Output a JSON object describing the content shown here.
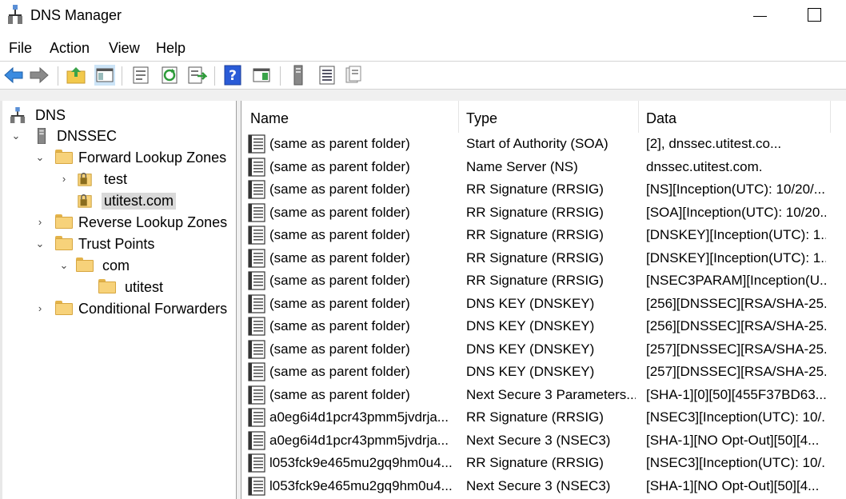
{
  "window": {
    "title": "DNS Manager"
  },
  "menu": [
    "File",
    "Action",
    "View",
    "Help"
  ],
  "toolbar": {
    "icons": [
      "back-arrow-icon",
      "forward-arrow-icon",
      "up-folder-icon",
      "show-hide-tree-icon",
      "properties-icon",
      "refresh-icon",
      "export-list-icon",
      "help-icon",
      "console-icon",
      "server-icon",
      "list-view-icon",
      "details-view-icon"
    ]
  },
  "tree": {
    "items": [
      {
        "label": "DNS",
        "level": 0,
        "chevron": "",
        "icon": "dns-server-icon"
      },
      {
        "label": "DNSSEC",
        "level": 1,
        "chevron": "v",
        "icon": "server-icon"
      },
      {
        "label": "Forward Lookup Zones",
        "level": 2,
        "chevron": "v",
        "icon": "folder-icon"
      },
      {
        "label": "test",
        "level": 3,
        "chevron": ">",
        "icon": "signed-zone-icon"
      },
      {
        "label": "utitest.com",
        "level": 3,
        "chevron": "",
        "icon": "signed-zone-icon",
        "selected": true
      },
      {
        "label": "Reverse Lookup Zones",
        "level": 2,
        "chevron": ">",
        "icon": "folder-icon"
      },
      {
        "label": "Trust Points",
        "level": 2,
        "chevron": "v",
        "icon": "folder-icon"
      },
      {
        "label": "com",
        "level": 3,
        "chevron": "v",
        "icon": "folder-icon"
      },
      {
        "label": "utitest",
        "level": 4,
        "chevron": "",
        "icon": "folder-icon"
      },
      {
        "label": "Conditional Forwarders",
        "level": 2,
        "chevron": ">",
        "icon": "folder-icon"
      }
    ]
  },
  "list": {
    "columns": [
      "Name",
      "Type",
      "Data"
    ],
    "rows": [
      [
        "(same as parent folder)",
        "Start of Authority (SOA)",
        "[2], dnssec.utitest.co..."
      ],
      [
        "(same as parent folder)",
        "Name Server (NS)",
        "dnssec.utitest.com."
      ],
      [
        "(same as parent folder)",
        "RR Signature (RRSIG)",
        "[NS][Inception(UTC): 10/20/..."
      ],
      [
        "(same as parent folder)",
        "RR Signature (RRSIG)",
        "[SOA][Inception(UTC): 10/20..."
      ],
      [
        "(same as parent folder)",
        "RR Signature (RRSIG)",
        "[DNSKEY][Inception(UTC): 1..."
      ],
      [
        "(same as parent folder)",
        "RR Signature (RRSIG)",
        "[DNSKEY][Inception(UTC): 1..."
      ],
      [
        "(same as parent folder)",
        "RR Signature (RRSIG)",
        "[NSEC3PARAM][Inception(U..."
      ],
      [
        "(same as parent folder)",
        "DNS KEY (DNSKEY)",
        "[256][DNSSEC][RSA/SHA-25..."
      ],
      [
        "(same as parent folder)",
        "DNS KEY (DNSKEY)",
        "[256][DNSSEC][RSA/SHA-25..."
      ],
      [
        "(same as parent folder)",
        "DNS KEY (DNSKEY)",
        "[257][DNSSEC][RSA/SHA-25..."
      ],
      [
        "(same as parent folder)",
        "DNS KEY (DNSKEY)",
        "[257][DNSSEC][RSA/SHA-25..."
      ],
      [
        "(same as parent folder)",
        "Next Secure 3 Parameters...",
        "[SHA-1][0][50][455F37BD63..."
      ],
      [
        "a0eg6i4d1pcr43pmm5jvdrja...",
        "RR Signature (RRSIG)",
        "[NSEC3][Inception(UTC): 10/..."
      ],
      [
        "a0eg6i4d1pcr43pmm5jvdrja...",
        "Next Secure 3 (NSEC3)",
        "[SHA-1][NO Opt-Out][50][4..."
      ],
      [
        "l053fck9e465mu2gq9hm0u4...",
        "RR Signature (RRSIG)",
        "[NSEC3][Inception(UTC): 10/..."
      ],
      [
        "l053fck9e465mu2gq9hm0u4...",
        "Next Secure 3 (NSEC3)",
        "[SHA-1][NO Opt-Out][50][4..."
      ]
    ]
  },
  "colors": {
    "selection": "#d9d9d9",
    "folder": "#f7d27a",
    "help": "#2a5bd7"
  }
}
